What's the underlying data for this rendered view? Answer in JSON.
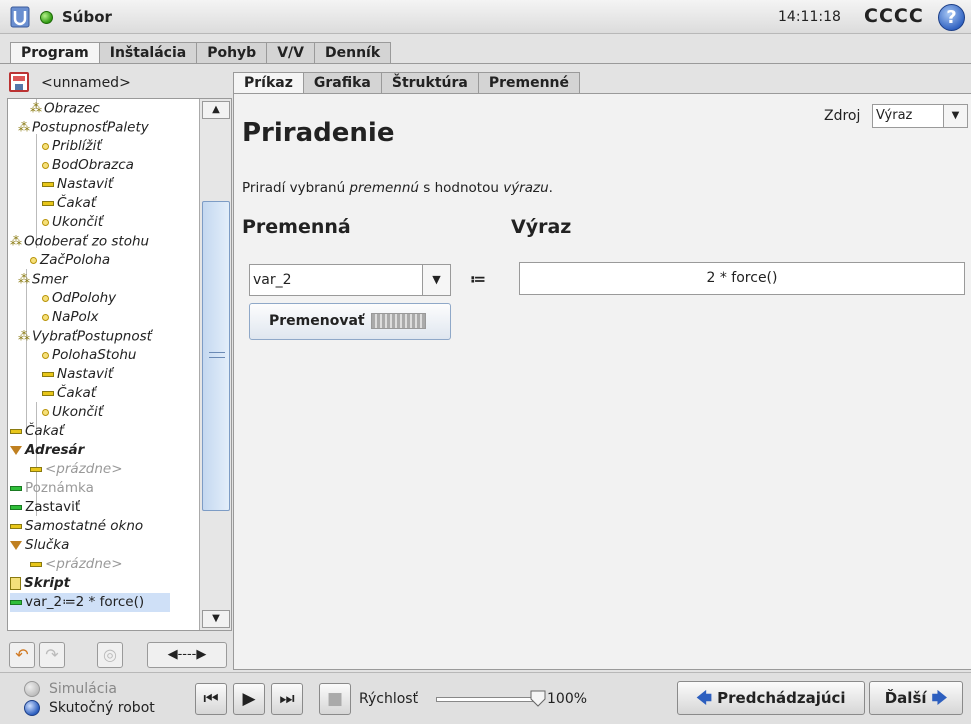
{
  "header": {
    "file_label": "Súbor",
    "clock": "14:11:18",
    "robot_name": "CCCC",
    "help_glyph": "?"
  },
  "main_tabs": [
    "Program",
    "Inštalácia",
    "Pohyb",
    "V/V",
    "Denník"
  ],
  "program_name": "<unnamed>",
  "tree": [
    {
      "label": "Obrazec"
    },
    {
      "label": "PostupnosťPalety"
    },
    {
      "label": "Priblížiť"
    },
    {
      "label": "BodObrazca"
    },
    {
      "label": "Nastaviť"
    },
    {
      "label": "Čakať"
    },
    {
      "label": "Ukončiť"
    },
    {
      "label": "Odoberať zo stohu"
    },
    {
      "label": "ZačPoloha"
    },
    {
      "label": "Smer"
    },
    {
      "label": "OdPolohy"
    },
    {
      "label": "NaPolx"
    },
    {
      "label": "VybraťPostupnosť"
    },
    {
      "label": "PolohaStohu"
    },
    {
      "label": "Nastaviť"
    },
    {
      "label": "Čakať"
    },
    {
      "label": "Ukončiť"
    },
    {
      "label": "Čakať"
    },
    {
      "label": "Adresár"
    },
    {
      "label": "<prázdne>"
    },
    {
      "label": "Poznámka"
    },
    {
      "label": "Zastaviť"
    },
    {
      "label": "Samostatné okno"
    },
    {
      "label": "Slučka"
    },
    {
      "label": "<prázdne>"
    },
    {
      "label": "Skript"
    },
    {
      "label": "var_2≔2 * force()"
    }
  ],
  "sub_tabs": [
    "Príkaz",
    "Grafika",
    "Štruktúra",
    "Premenné"
  ],
  "command": {
    "source_label": "Zdroj",
    "source_value": "Výraz",
    "title": "Priradenie",
    "desc_pre": "Priradí vybranú ",
    "desc_var": "premennú",
    "desc_mid": " s hodnotou ",
    "desc_expr": "výrazu",
    "desc_end": ".",
    "var_heading": "Premenná",
    "expr_heading": "Výraz",
    "var_value": "var_2",
    "assign_op": "≔",
    "expr_value": "2 * force()",
    "rename_label": "Premenovať"
  },
  "footer": {
    "simulation_label": "Simulácia",
    "real_robot_label": "Skutočný robot",
    "speed_label": "Rýchlosť",
    "speed_value": "100%",
    "speed_fraction": 1.0,
    "prev_label": "Predchádzajúci",
    "next_label": "Ďalší"
  },
  "colors": {
    "accent_blue": "#2d5fbf",
    "active_green": "#2fbf3a",
    "node_yellow": "#e8c61a"
  }
}
